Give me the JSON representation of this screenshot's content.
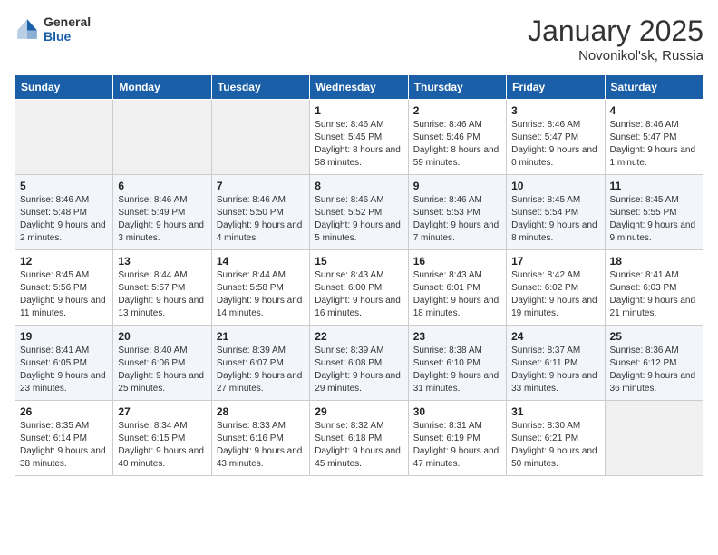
{
  "header": {
    "logo_general": "General",
    "logo_blue": "Blue",
    "title": "January 2025",
    "subtitle": "Novonikol'sk, Russia"
  },
  "days_of_week": [
    "Sunday",
    "Monday",
    "Tuesday",
    "Wednesday",
    "Thursday",
    "Friday",
    "Saturday"
  ],
  "weeks": [
    [
      {
        "day": "",
        "empty": true
      },
      {
        "day": "",
        "empty": true
      },
      {
        "day": "",
        "empty": true
      },
      {
        "day": "1",
        "sunrise": "Sunrise: 8:46 AM",
        "sunset": "Sunset: 5:45 PM",
        "daylight": "Daylight: 8 hours and 58 minutes."
      },
      {
        "day": "2",
        "sunrise": "Sunrise: 8:46 AM",
        "sunset": "Sunset: 5:46 PM",
        "daylight": "Daylight: 8 hours and 59 minutes."
      },
      {
        "day": "3",
        "sunrise": "Sunrise: 8:46 AM",
        "sunset": "Sunset: 5:47 PM",
        "daylight": "Daylight: 9 hours and 0 minutes."
      },
      {
        "day": "4",
        "sunrise": "Sunrise: 8:46 AM",
        "sunset": "Sunset: 5:47 PM",
        "daylight": "Daylight: 9 hours and 1 minute."
      }
    ],
    [
      {
        "day": "5",
        "sunrise": "Sunrise: 8:46 AM",
        "sunset": "Sunset: 5:48 PM",
        "daylight": "Daylight: 9 hours and 2 minutes."
      },
      {
        "day": "6",
        "sunrise": "Sunrise: 8:46 AM",
        "sunset": "Sunset: 5:49 PM",
        "daylight": "Daylight: 9 hours and 3 minutes."
      },
      {
        "day": "7",
        "sunrise": "Sunrise: 8:46 AM",
        "sunset": "Sunset: 5:50 PM",
        "daylight": "Daylight: 9 hours and 4 minutes."
      },
      {
        "day": "8",
        "sunrise": "Sunrise: 8:46 AM",
        "sunset": "Sunset: 5:52 PM",
        "daylight": "Daylight: 9 hours and 5 minutes."
      },
      {
        "day": "9",
        "sunrise": "Sunrise: 8:46 AM",
        "sunset": "Sunset: 5:53 PM",
        "daylight": "Daylight: 9 hours and 7 minutes."
      },
      {
        "day": "10",
        "sunrise": "Sunrise: 8:45 AM",
        "sunset": "Sunset: 5:54 PM",
        "daylight": "Daylight: 9 hours and 8 minutes."
      },
      {
        "day": "11",
        "sunrise": "Sunrise: 8:45 AM",
        "sunset": "Sunset: 5:55 PM",
        "daylight": "Daylight: 9 hours and 9 minutes."
      }
    ],
    [
      {
        "day": "12",
        "sunrise": "Sunrise: 8:45 AM",
        "sunset": "Sunset: 5:56 PM",
        "daylight": "Daylight: 9 hours and 11 minutes."
      },
      {
        "day": "13",
        "sunrise": "Sunrise: 8:44 AM",
        "sunset": "Sunset: 5:57 PM",
        "daylight": "Daylight: 9 hours and 13 minutes."
      },
      {
        "day": "14",
        "sunrise": "Sunrise: 8:44 AM",
        "sunset": "Sunset: 5:58 PM",
        "daylight": "Daylight: 9 hours and 14 minutes."
      },
      {
        "day": "15",
        "sunrise": "Sunrise: 8:43 AM",
        "sunset": "Sunset: 6:00 PM",
        "daylight": "Daylight: 9 hours and 16 minutes."
      },
      {
        "day": "16",
        "sunrise": "Sunrise: 8:43 AM",
        "sunset": "Sunset: 6:01 PM",
        "daylight": "Daylight: 9 hours and 18 minutes."
      },
      {
        "day": "17",
        "sunrise": "Sunrise: 8:42 AM",
        "sunset": "Sunset: 6:02 PM",
        "daylight": "Daylight: 9 hours and 19 minutes."
      },
      {
        "day": "18",
        "sunrise": "Sunrise: 8:41 AM",
        "sunset": "Sunset: 6:03 PM",
        "daylight": "Daylight: 9 hours and 21 minutes."
      }
    ],
    [
      {
        "day": "19",
        "sunrise": "Sunrise: 8:41 AM",
        "sunset": "Sunset: 6:05 PM",
        "daylight": "Daylight: 9 hours and 23 minutes."
      },
      {
        "day": "20",
        "sunrise": "Sunrise: 8:40 AM",
        "sunset": "Sunset: 6:06 PM",
        "daylight": "Daylight: 9 hours and 25 minutes."
      },
      {
        "day": "21",
        "sunrise": "Sunrise: 8:39 AM",
        "sunset": "Sunset: 6:07 PM",
        "daylight": "Daylight: 9 hours and 27 minutes."
      },
      {
        "day": "22",
        "sunrise": "Sunrise: 8:39 AM",
        "sunset": "Sunset: 6:08 PM",
        "daylight": "Daylight: 9 hours and 29 minutes."
      },
      {
        "day": "23",
        "sunrise": "Sunrise: 8:38 AM",
        "sunset": "Sunset: 6:10 PM",
        "daylight": "Daylight: 9 hours and 31 minutes."
      },
      {
        "day": "24",
        "sunrise": "Sunrise: 8:37 AM",
        "sunset": "Sunset: 6:11 PM",
        "daylight": "Daylight: 9 hours and 33 minutes."
      },
      {
        "day": "25",
        "sunrise": "Sunrise: 8:36 AM",
        "sunset": "Sunset: 6:12 PM",
        "daylight": "Daylight: 9 hours and 36 minutes."
      }
    ],
    [
      {
        "day": "26",
        "sunrise": "Sunrise: 8:35 AM",
        "sunset": "Sunset: 6:14 PM",
        "daylight": "Daylight: 9 hours and 38 minutes."
      },
      {
        "day": "27",
        "sunrise": "Sunrise: 8:34 AM",
        "sunset": "Sunset: 6:15 PM",
        "daylight": "Daylight: 9 hours and 40 minutes."
      },
      {
        "day": "28",
        "sunrise": "Sunrise: 8:33 AM",
        "sunset": "Sunset: 6:16 PM",
        "daylight": "Daylight: 9 hours and 43 minutes."
      },
      {
        "day": "29",
        "sunrise": "Sunrise: 8:32 AM",
        "sunset": "Sunset: 6:18 PM",
        "daylight": "Daylight: 9 hours and 45 minutes."
      },
      {
        "day": "30",
        "sunrise": "Sunrise: 8:31 AM",
        "sunset": "Sunset: 6:19 PM",
        "daylight": "Daylight: 9 hours and 47 minutes."
      },
      {
        "day": "31",
        "sunrise": "Sunrise: 8:30 AM",
        "sunset": "Sunset: 6:21 PM",
        "daylight": "Daylight: 9 hours and 50 minutes."
      },
      {
        "day": "",
        "empty": true
      }
    ]
  ]
}
